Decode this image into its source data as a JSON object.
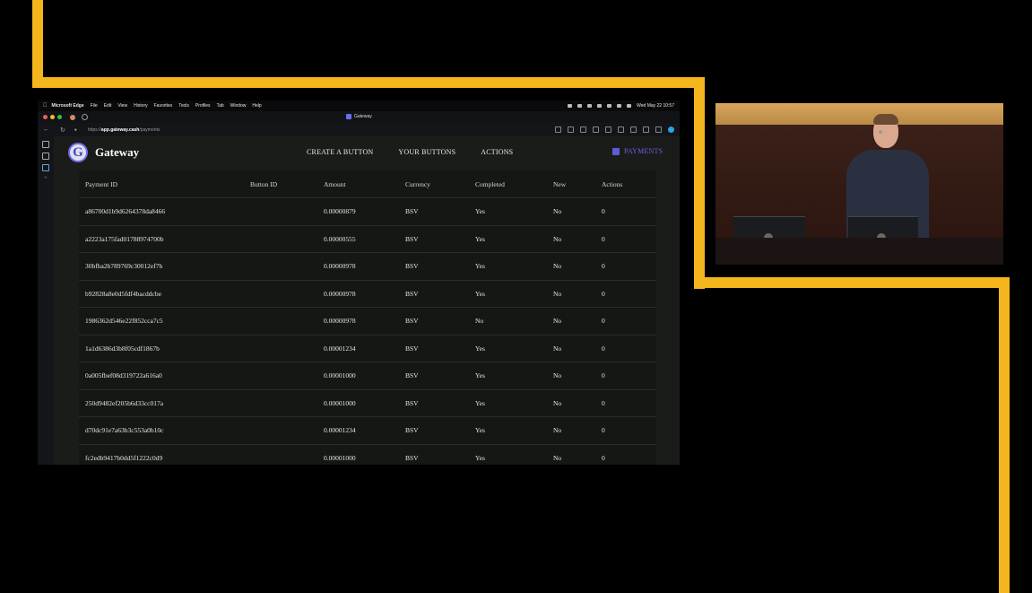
{
  "menubar": {
    "app_name": "Microsoft Edge",
    "items": [
      "File",
      "Edit",
      "View",
      "History",
      "Favorites",
      "Tools",
      "Profiles",
      "Tab",
      "Window",
      "Help"
    ],
    "datetime": "Wed May 22  10:57"
  },
  "browser": {
    "tab_title": "Gateway",
    "url_scheme": "https://",
    "url_host": "app.gateway.cash",
    "url_path": "/payments"
  },
  "app": {
    "logo_letter": "G",
    "brand": "Gateway",
    "nav": {
      "create": "CREATE A BUTTON",
      "yours": "YOUR BUTTONS",
      "actions": "ACTIONS",
      "payments": "PAYMENTS"
    }
  },
  "table": {
    "headers": [
      "Payment ID",
      "Button ID",
      "Amount",
      "Currency",
      "Completed",
      "New",
      "Actions"
    ],
    "rows": [
      [
        "a86700d1b9d6264378da8466",
        "",
        "0.00000879",
        "BSV",
        "Yes",
        "No",
        "0"
      ],
      [
        "a2223a175fad01788974700b",
        "",
        "0.00000555",
        "BSV",
        "Yes",
        "No",
        "0"
      ],
      [
        "30bfba2b789769c30012ef7b",
        "",
        "0.00000978",
        "BSV",
        "Yes",
        "No",
        "0"
      ],
      [
        "b92828a8e0d5fdf4bacddcbe",
        "",
        "0.00000978",
        "BSV",
        "Yes",
        "No",
        "0"
      ],
      [
        "1986362d546e22f852cca7c5",
        "",
        "0.00000978",
        "BSV",
        "No",
        "No",
        "0"
      ],
      [
        "1a1d6386d3b8f05cdf1867b",
        "",
        "0.00001234",
        "BSV",
        "Yes",
        "No",
        "0"
      ],
      [
        "0a005fbef08d319722a616a0",
        "",
        "0.00001000",
        "BSV",
        "Yes",
        "No",
        "0"
      ],
      [
        "250d9482ef205b6d33cc017a",
        "",
        "0.00001000",
        "BSV",
        "Yes",
        "No",
        "0"
      ],
      [
        "d70dc91e7a63b3c553a0b10c",
        "",
        "0.00001234",
        "BSV",
        "Yes",
        "No",
        "0"
      ],
      [
        "fc2edb9417b0dd5f1222c0d9",
        "",
        "0.00001000",
        "BSV",
        "Yes",
        "No",
        "0"
      ]
    ]
  },
  "colors": {
    "frame_accent": "#f4b51d",
    "brand_accent": "#6464e6",
    "page_bg": "#1a1c1a"
  }
}
